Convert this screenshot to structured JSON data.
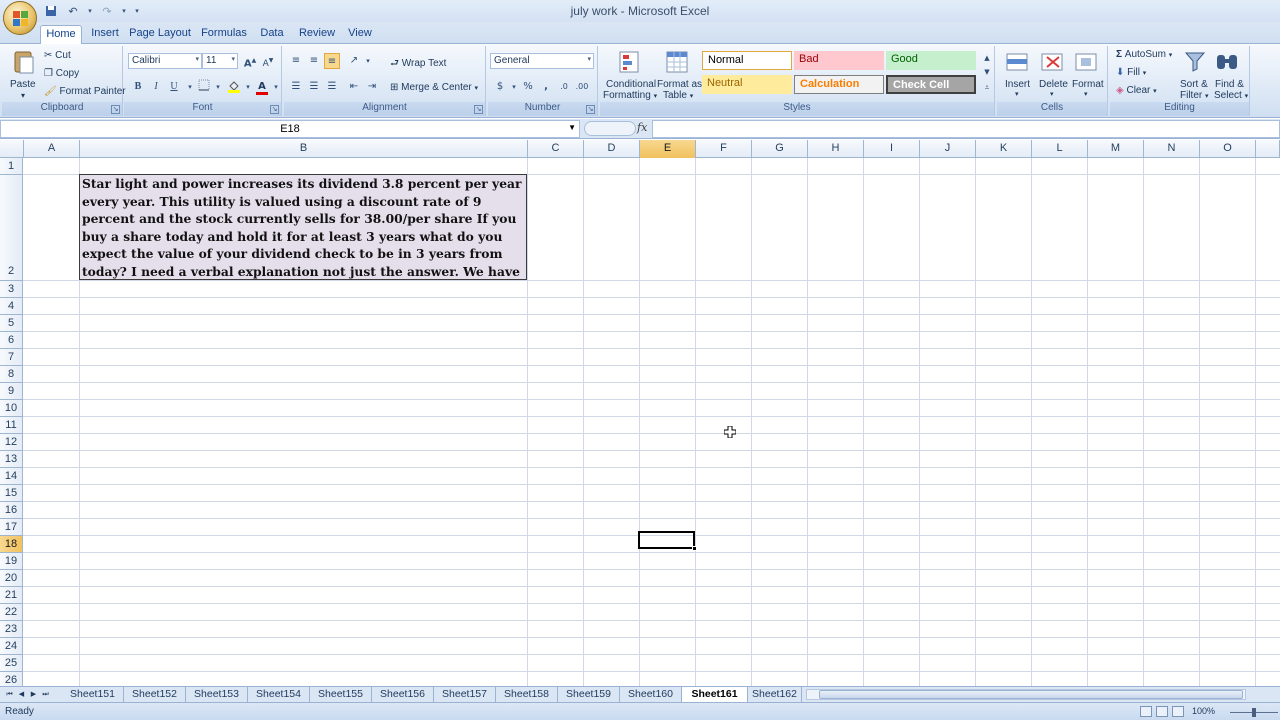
{
  "window": {
    "title": "july work - Microsoft Excel"
  },
  "tabs": [
    {
      "label": "Home",
      "active": true
    },
    {
      "label": "Insert"
    },
    {
      "label": "Page Layout"
    },
    {
      "label": "Formulas"
    },
    {
      "label": "Data"
    },
    {
      "label": "Review"
    },
    {
      "label": "View"
    }
  ],
  "ribbon": {
    "clipboard": {
      "label": "Clipboard",
      "paste": "Paste",
      "cut": "Cut",
      "copy": "Copy",
      "format_painter": "Format Painter"
    },
    "font": {
      "label": "Font",
      "name": "Calibri",
      "size": "11",
      "bold": "B",
      "italic": "I",
      "underline": "U"
    },
    "alignment": {
      "label": "Alignment",
      "wrap_text": "Wrap Text",
      "merge_center": "Merge & Center"
    },
    "number": {
      "label": "Number",
      "format": "General",
      "currency": "$",
      "percent": "%",
      "comma": ","
    },
    "styles": {
      "label": "Styles",
      "conditional_1": "Conditional",
      "conditional_2": "Formatting",
      "format_table_1": "Format as",
      "format_table_2": "Table",
      "items": [
        {
          "label": "Normal",
          "bg": "#ffffff",
          "color": "#000000"
        },
        {
          "label": "Bad",
          "bg": "#ffc7ce",
          "color": "#9c0006"
        },
        {
          "label": "Good",
          "bg": "#c6efce",
          "color": "#006100"
        },
        {
          "label": "Neutral",
          "bg": "#ffeb9c",
          "color": "#9c6500"
        },
        {
          "label": "Calculation",
          "bg": "#f2f2f2",
          "color": "#fa7d00"
        },
        {
          "label": "Check Cell",
          "bg": "#a5a5a5",
          "color": "#ffffff"
        }
      ]
    },
    "cells": {
      "label": "Cells",
      "insert": "Insert",
      "delete": "Delete",
      "format": "Format"
    },
    "editing": {
      "label": "Editing",
      "autosum": "AutoSum",
      "fill": "Fill",
      "clear": "Clear",
      "sort_1": "Sort &",
      "sort_2": "Filter",
      "find_1": "Find &",
      "find_2": "Select"
    }
  },
  "formula_bar": {
    "name_box": "E18",
    "fx": "fx",
    "formula": ""
  },
  "columns": [
    "A",
    "B",
    "C",
    "D",
    "E",
    "F",
    "G",
    "H",
    "I",
    "J",
    "K",
    "L",
    "M",
    "N",
    "O"
  ],
  "selected_column": "E",
  "rows": [
    "1",
    "2",
    "3",
    "4",
    "5",
    "6",
    "7",
    "8",
    "9",
    "10",
    "11",
    "12",
    "13",
    "14",
    "15",
    "16",
    "17",
    "18",
    "19",
    "20",
    "21",
    "22",
    "23",
    "24",
    "25",
    "26"
  ],
  "selected_row": "18",
  "cell_B2": "Star light and power increases its dividend 3.8 percent per year every year. This utility is valued using a discount rate of 9 percent and the stock currently sells for 38.00/per share If you buy a share today and hold it for at least 3 years what do you expect the value of your dividend check to be in 3 years from today? I need a verbal explanation not just the answer. We have to explain it in words",
  "sheets": [
    "Sheet151",
    "Sheet152",
    "Sheet153",
    "Sheet154",
    "Sheet155",
    "Sheet156",
    "Sheet157",
    "Sheet158",
    "Sheet159",
    "Sheet160",
    "Sheet161",
    "Sheet162"
  ],
  "active_sheet": "Sheet161",
  "status": {
    "text": "Ready",
    "zoom": "100%"
  }
}
